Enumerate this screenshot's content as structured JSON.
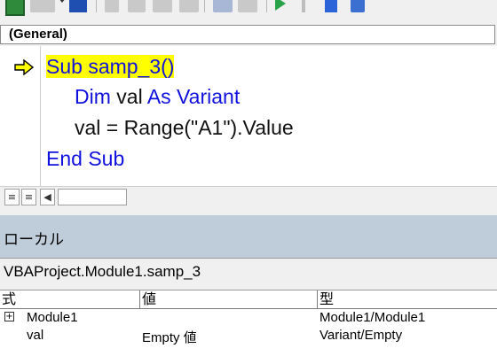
{
  "toolbar": {
    "icons": [
      "excel-icon",
      "insert-module-icon",
      "save-icon",
      "cut-icon",
      "copy-icon",
      "paste-icon",
      "find-icon",
      "undo-icon",
      "redo-icon",
      "run-icon",
      "break-icon",
      "reset-icon"
    ]
  },
  "object_combo": {
    "value": "(General)"
  },
  "code": {
    "lines": [
      "Sub samp_3()",
      "Dim ",
      "val ",
      "As Variant",
      "val = Range(\"A1\").Value",
      "End Sub"
    ],
    "current_line_index": 0
  },
  "code_bar": {
    "full_module_view": "≡",
    "procedure_view": "≡",
    "scroll_left": "◀"
  },
  "locals": {
    "title": "ローカル",
    "context": "VBAProject.Module1.samp_3",
    "columns": [
      "式",
      "値",
      "型"
    ],
    "rows": [
      {
        "expression": "Module1",
        "expandable": true,
        "value": "",
        "type": "Module1/Module1"
      },
      {
        "expression": "val",
        "expandable": false,
        "value": "Empty 値",
        "type": "Variant/Empty"
      }
    ]
  }
}
